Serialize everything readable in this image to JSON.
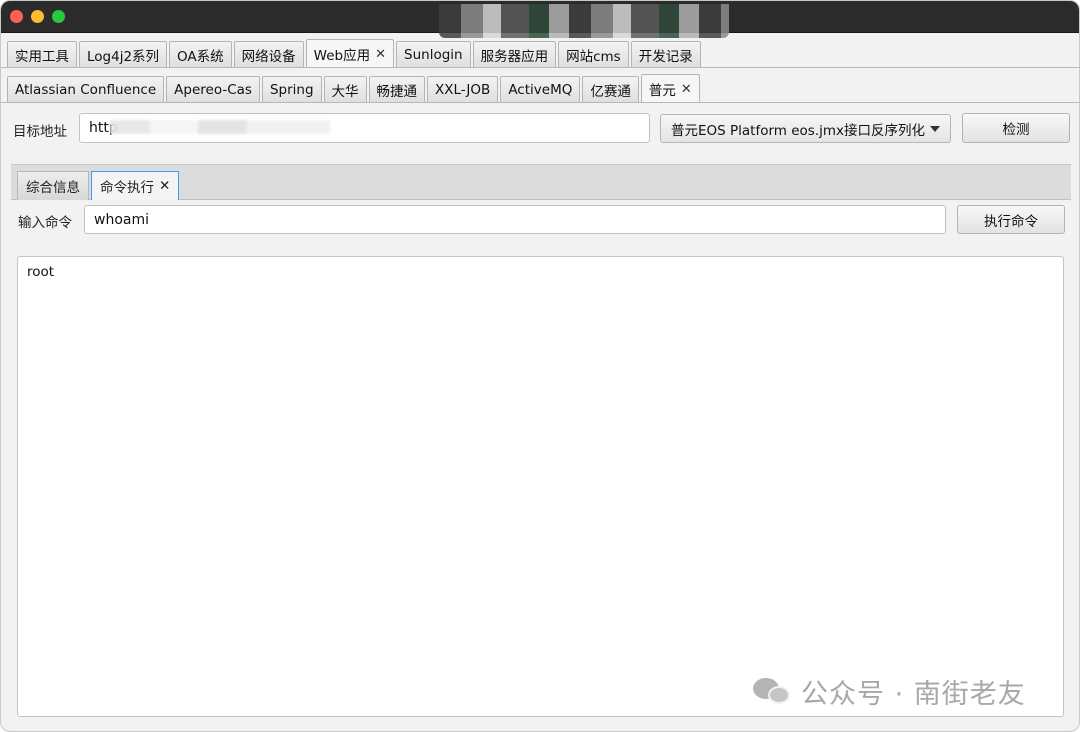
{
  "tabs_row1": [
    {
      "label": "实用工具"
    },
    {
      "label": "Log4j2系列"
    },
    {
      "label": "OA系统"
    },
    {
      "label": "网络设备"
    },
    {
      "label": "Web应用",
      "closable": true,
      "active": true
    },
    {
      "label": "Sunlogin"
    },
    {
      "label": "服务器应用"
    },
    {
      "label": "网站cms"
    },
    {
      "label": "开发记录"
    }
  ],
  "tabs_row2": [
    {
      "label": "Atlassian Confluence"
    },
    {
      "label": "Apereo-Cas"
    },
    {
      "label": "Spring"
    },
    {
      "label": "大华"
    },
    {
      "label": "畅捷通"
    },
    {
      "label": "XXL-JOB"
    },
    {
      "label": "ActiveMQ"
    },
    {
      "label": "亿赛通"
    },
    {
      "label": "普元",
      "closable": true,
      "active": true
    }
  ],
  "close_glyph": "✕",
  "target": {
    "label": "目标地址",
    "value": "http",
    "exploit_select": "普元EOS Platform eos.jmx接口反序列化",
    "check_button": "检测"
  },
  "subtabs": [
    {
      "label": "综合信息"
    },
    {
      "label": "命令执行",
      "closable": true,
      "active": true
    }
  ],
  "command": {
    "label": "输入命令",
    "value": "whoami",
    "run_button": "执行命令"
  },
  "output": {
    "text": "root"
  },
  "watermark": {
    "text": "公众号 · 南街老友"
  },
  "colors": {
    "titlebar": "#2b2b2b",
    "close": "#ff5f57",
    "minimize": "#febc2e",
    "maximize": "#28c840",
    "focus": "#3b99fc"
  }
}
